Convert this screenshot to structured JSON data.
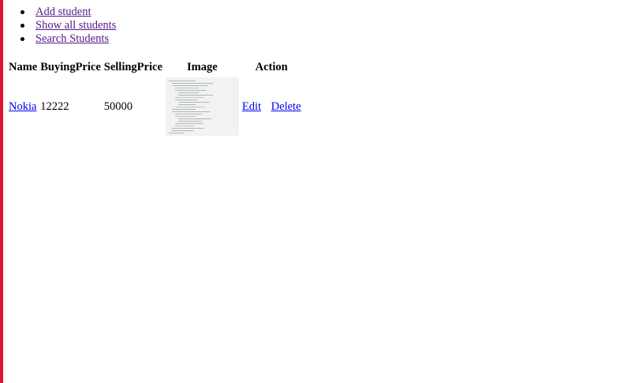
{
  "nav": {
    "items": [
      {
        "label": "Add student"
      },
      {
        "label": "Show all students"
      },
      {
        "label": "Search Students"
      }
    ]
  },
  "table": {
    "headers": [
      "Name",
      "BuyingPrice",
      "SellingPrice",
      "Image",
      "Action"
    ],
    "rows": [
      {
        "name": "Nokia",
        "buying_price": "12222",
        "selling_price": "50000",
        "image_alt": "product-code-screenshot-thumbnail",
        "edit_label": "Edit",
        "delete_label": "Delete"
      }
    ]
  },
  "colors": {
    "left_bar": "#e3122c",
    "visited_link": "#551a8b",
    "link": "#0000ee"
  }
}
